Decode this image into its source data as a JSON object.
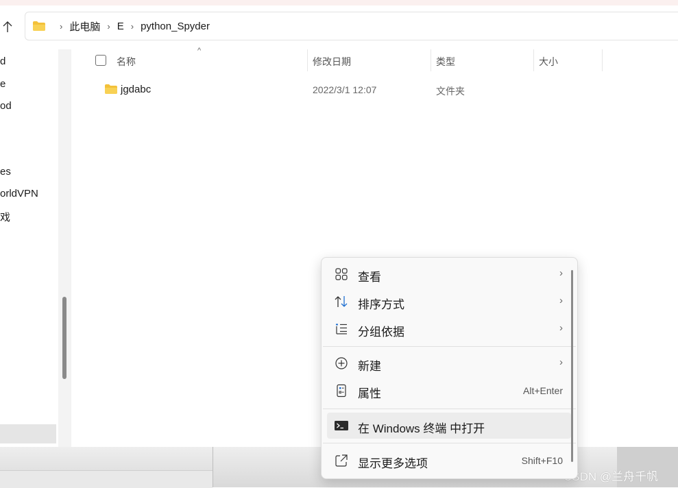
{
  "address_bar": {
    "crumbs": [
      "此电脑",
      "E",
      "python_Spyder"
    ]
  },
  "nav_pane": {
    "items": [
      "d",
      "e",
      "od",
      "es",
      "orldVPN",
      "戏"
    ]
  },
  "columns": {
    "name": "名称",
    "modified": "修改日期",
    "type": "类型",
    "size": "大小"
  },
  "files": [
    {
      "name": "jgdabc",
      "modified": "2022/3/1 12:07",
      "type": "文件夹"
    }
  ],
  "context_menu": {
    "items": [
      {
        "label": "查看",
        "icon": "grid-icon",
        "submenu": true
      },
      {
        "label": "排序方式",
        "icon": "sort-icon",
        "submenu": true
      },
      {
        "label": "分组依据",
        "icon": "group-list-icon",
        "submenu": true
      },
      {
        "label": "新建",
        "icon": "plus-circle-icon",
        "submenu": true
      },
      {
        "label": "属性",
        "icon": "properties-icon",
        "shortcut": "Alt+Enter"
      },
      {
        "label": "在 Windows 终端 中打开",
        "icon": "terminal-icon"
      },
      {
        "label": "显示更多选项",
        "icon": "external-open-icon",
        "shortcut": "Shift+F10"
      }
    ],
    "submenu_arrow": "›"
  },
  "watermark": "CSDN @兰舟千帆",
  "colors": {
    "folder": "#f3c13a",
    "hover": "#ececec"
  }
}
